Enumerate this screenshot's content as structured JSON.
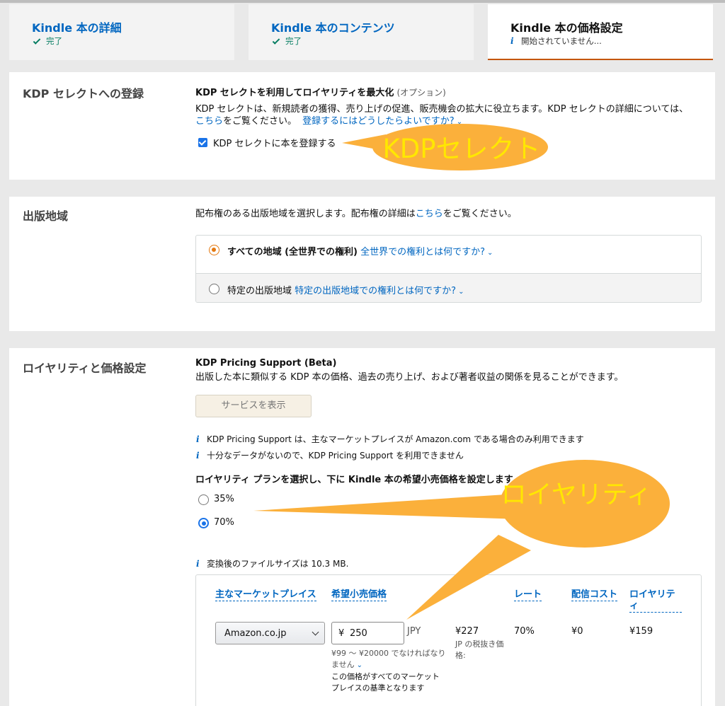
{
  "steps": [
    {
      "title": "Kindle 本の詳細",
      "status": "完了"
    },
    {
      "title": "Kindle 本のコンテンツ",
      "status": "完了"
    },
    {
      "title": "Kindle 本の価格設定",
      "status": "開始されていません..."
    }
  ],
  "kdp_select": {
    "section_title": "KDP セレクトへの登録",
    "heading": "KDP セレクトを利用してロイヤリティを最大化",
    "optional": "(オプション)",
    "desc": "KDP セレクトは、新規読者の獲得、売り上げの促進、販売機会の拡大に役立ちます。KDP セレクトの詳細については、",
    "link_here": "こちら",
    "desc_suffix": "をご覧ください。",
    "link_how": "登録するにはどうしたらよいですか?",
    "checkbox_label": "KDP セレクトに本を登録する",
    "checkbox_checked": true
  },
  "territories": {
    "section_title": "出版地域",
    "desc": "配布権のある出版地域を選択します。配布権の詳細は",
    "link_here": "こちら",
    "desc_suffix": "をご覧ください。",
    "option_all": "すべての地域 (全世界での権利)",
    "option_all_link": "全世界での権利とは何ですか?",
    "option_specific": "特定の出版地域",
    "option_specific_link": "特定の出版地域での権利とは何ですか?",
    "selected": "all"
  },
  "royalty": {
    "section_title": "ロイヤリティと価格設定",
    "support_heading": "KDP Pricing Support (Beta)",
    "support_desc": "出版した本に類似する KDP 本の価格、過去の売り上げ、および著者収益の関係を見ることができます。",
    "service_button": "サービスを表示",
    "info1": "KDP Pricing Support は、主なマーケットプレイスが Amazon.com である場合のみ利用できます",
    "info2": "十分なデータがないので、KDP Pricing Support を利用できません",
    "plan_heading": "ロイヤリティ プランを選択し、下に Kindle 本の希望小売価格を設定します",
    "plan_35": "35%",
    "plan_70": "70%",
    "selected_plan": "70%",
    "file_size_info": "変換後のファイルサイズは 10.3 MB.",
    "table": {
      "headers": {
        "marketplace": "主なマーケットプレイス",
        "list_price": "希望小売価格",
        "rate": "レート",
        "delivery_cost": "配信コスト",
        "royalty_l1": "ロイヤリテ",
        "royalty_l2": "ィ"
      },
      "marketplace_value": "Amazon.co.jp",
      "currency_symbol": "¥",
      "price_value": "250",
      "currency": "JPY",
      "price_range_l1": "¥99 〜 ¥20000 でなければなり",
      "price_range_l2": "ません",
      "base_note_l1": "この価格がすべてのマーケット",
      "base_note_l2": "プレイスの基準となります",
      "net_price": "¥227",
      "net_note_l1": "JP の税抜き価",
      "net_note_l2": "格:",
      "rate_value": "70%",
      "delivery_value": "¥0",
      "royalty_value": "¥159"
    }
  },
  "annotations": {
    "kdp_select_callout": "KDPセレクト",
    "royalty_callout": "ロイヤリティ",
    "callout_color": "#fbb03b",
    "callout_text_color": "#ffe700"
  }
}
